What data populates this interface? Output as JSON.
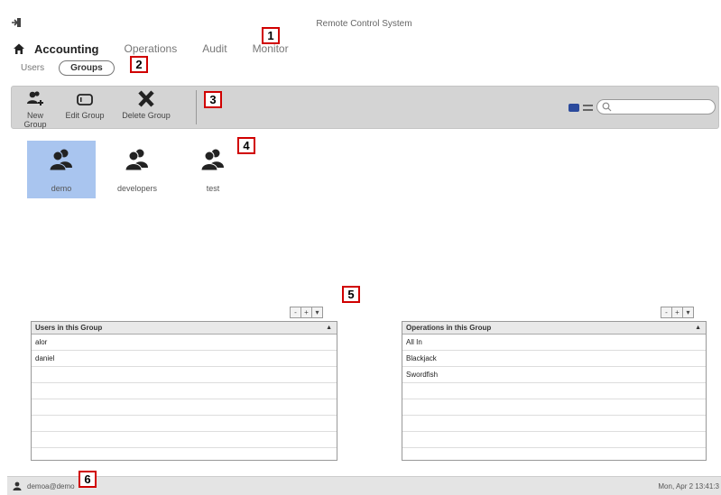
{
  "window": {
    "title": "Remote Control System"
  },
  "nav": {
    "items": [
      {
        "label": "Accounting",
        "active": true
      },
      {
        "label": "Operations",
        "active": false
      },
      {
        "label": "Audit",
        "active": false
      },
      {
        "label": "Monitor",
        "active": false
      }
    ]
  },
  "subnav": {
    "items": [
      {
        "label": "Users",
        "active": false
      },
      {
        "label": "Groups",
        "active": true
      }
    ]
  },
  "toolbar": {
    "new_group": "New Group",
    "edit_group": "Edit Group",
    "delete_group": "Delete Group",
    "search_placeholder": ""
  },
  "groups": [
    {
      "label": "demo",
      "selected": true
    },
    {
      "label": "developers",
      "selected": false
    },
    {
      "label": "test",
      "selected": false
    }
  ],
  "users_panel": {
    "header": "Users in this Group",
    "buttons": [
      "-",
      "+",
      "▾"
    ],
    "rows": [
      "alor",
      "daniel"
    ]
  },
  "operations_panel": {
    "header": "Operations in this Group",
    "buttons": [
      "-",
      "+",
      "▾"
    ],
    "rows": [
      "All In",
      "Blackjack",
      "Swordfish"
    ]
  },
  "status": {
    "user": "demoa@demo",
    "time": "Mon, Apr 2  13:41:3"
  },
  "callouts": [
    "1",
    "2",
    "3",
    "4",
    "5",
    "6"
  ],
  "colors": {
    "selected_bg": "#a9c5ef",
    "toolbar_bg": "#d4d4d4",
    "callout_border": "#d00000",
    "grid_view_active": "#2b4a9c"
  }
}
